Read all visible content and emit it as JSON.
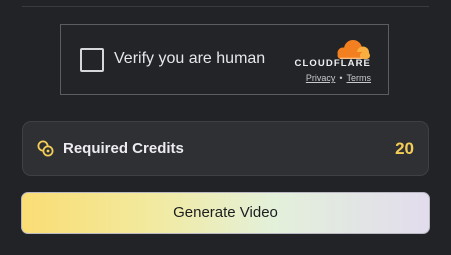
{
  "turnstile": {
    "checkbox_checked": false,
    "label": "Verify you are human",
    "brand": "CLOUDFLARE",
    "privacy_link": "Privacy",
    "separator": "•",
    "terms_link": "Terms",
    "logo_colors": [
      "#f38020",
      "#faae40"
    ]
  },
  "credits": {
    "label": "Required Credits",
    "value": "20",
    "icon": "coins-icon",
    "accent_color": "#f3cd56"
  },
  "actions": {
    "generate_label": "Generate Video"
  },
  "colors": {
    "background": "#222327",
    "card": "#2f3034"
  }
}
